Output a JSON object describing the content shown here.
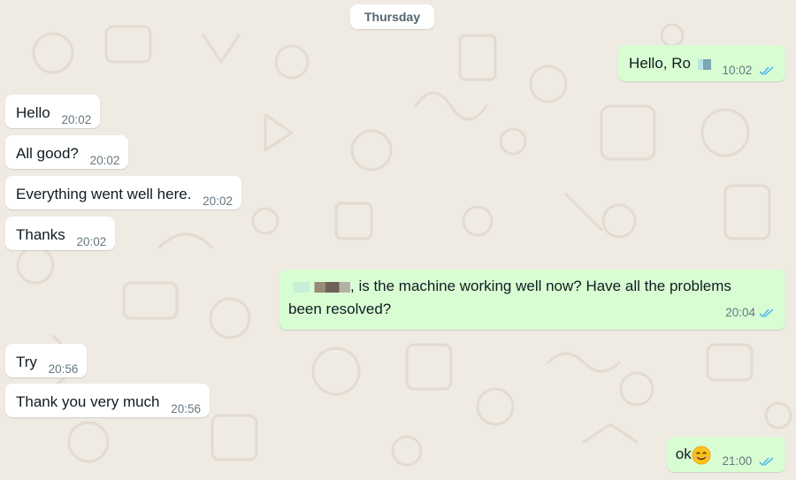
{
  "day_separator": "Thursday",
  "colors": {
    "wallpaper": "#efeae2",
    "incoming_bubble": "#ffffff",
    "outgoing_bubble": "#d9fdd3",
    "read_ticks": "#53bdeb",
    "timestamp": "#667781"
  },
  "messages": [
    {
      "direction": "out",
      "text": "Hello, Ro",
      "time": "10:02",
      "status": "read-double-check-icon"
    },
    {
      "direction": "in",
      "text": "Hello",
      "time": "20:02"
    },
    {
      "direction": "in",
      "text": "All good?",
      "time": "20:02"
    },
    {
      "direction": "in",
      "text": "Everything went well here.",
      "time": "20:02"
    },
    {
      "direction": "in",
      "text": "Thanks",
      "time": "20:02"
    },
    {
      "direction": "out",
      "text_line1": ", is the machine working well now? Have all the problems",
      "text_line2": "been resolved?",
      "time": "20:04",
      "status": "read-double-check-icon"
    },
    {
      "direction": "in",
      "text": "Try",
      "time": "20:56"
    },
    {
      "direction": "in",
      "text": "Thank you very much",
      "time": "20:56"
    },
    {
      "direction": "out",
      "text": "ok",
      "emoji": "smiling-face-emoji",
      "time": "21:00",
      "status": "read-double-check-icon"
    }
  ]
}
